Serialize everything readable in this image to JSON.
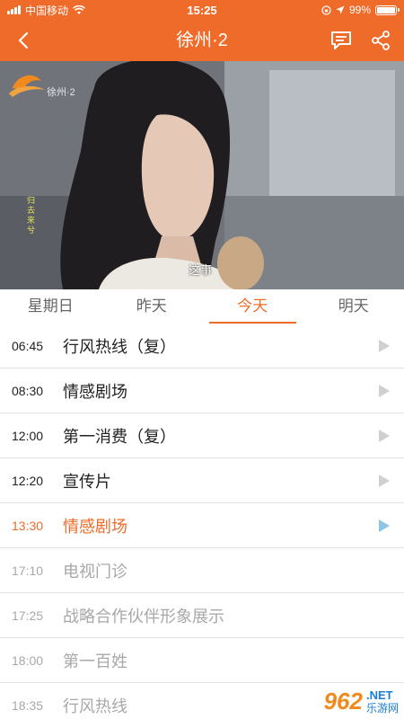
{
  "status_bar": {
    "carrier": "中国移动",
    "time": "15:25",
    "battery_text": "99%",
    "battery_level": 0.99
  },
  "nav": {
    "title": "徐州·2",
    "icons": [
      "back-chevron-icon",
      "comment-icon",
      "share-icon"
    ]
  },
  "video": {
    "channel_logo": "徐州·2",
    "vertical_caption": "归去来兮",
    "subtitle": "这事"
  },
  "tabs": [
    {
      "label": "星期日",
      "active": false
    },
    {
      "label": "昨天",
      "active": false
    },
    {
      "label": "今天",
      "active": true
    },
    {
      "label": "明天",
      "active": false
    }
  ],
  "schedule": [
    {
      "time": "06:45",
      "title": "行风热线（复）",
      "state": "past"
    },
    {
      "time": "08:30",
      "title": "情感剧场",
      "state": "past"
    },
    {
      "time": "12:00",
      "title": "第一消费（复）",
      "state": "past"
    },
    {
      "time": "12:20",
      "title": "宣传片",
      "state": "past"
    },
    {
      "time": "13:30",
      "title": "情感剧场",
      "state": "current"
    },
    {
      "time": "17:10",
      "title": "电视门诊",
      "state": "future"
    },
    {
      "time": "17:25",
      "title": "战略合作伙伴形象展示",
      "state": "future"
    },
    {
      "time": "18:00",
      "title": "第一百姓",
      "state": "future"
    },
    {
      "time": "18:35",
      "title": "行风热线",
      "state": "future"
    }
  ],
  "watermark": {
    "logo": "962",
    "site": ".NET",
    "name": "乐游网"
  },
  "colors": {
    "accent": "#ef6b2a",
    "current_play": "#8fc3e6",
    "future_text": "#a8a8a8"
  }
}
